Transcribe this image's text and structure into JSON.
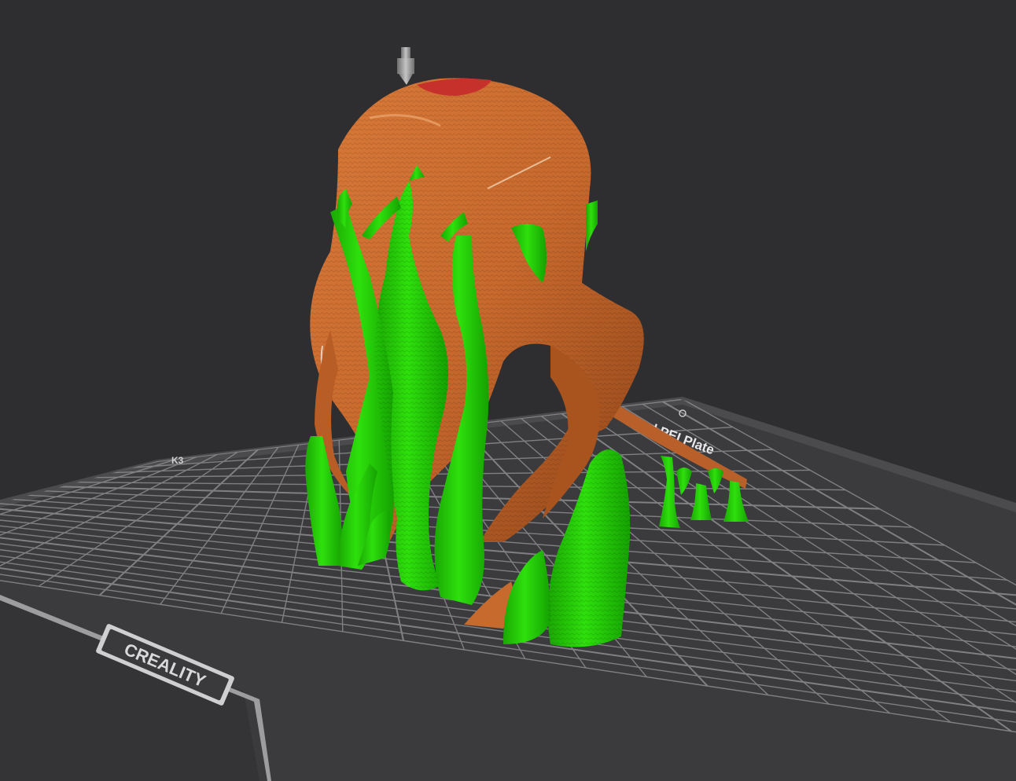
{
  "scene": {
    "bed_brand_label": "CREALITY",
    "plate_label": "Textured PEI Plate",
    "plate_label_visible": "ured PEI Plate",
    "plate_corner_logo": "K3"
  },
  "colors": {
    "background": "#2e2e31",
    "plate_surface": "#3c3c3f",
    "grid_line": "#8a8a8d",
    "plate_edge": "#6c6c70",
    "model_shell": "#c8692d",
    "model_shell_dark": "#9a4b1c",
    "model_top": "#c9302a",
    "support": "#26d406",
    "support_dark": "#13a602",
    "nozzle": "#9a9a9a"
  }
}
